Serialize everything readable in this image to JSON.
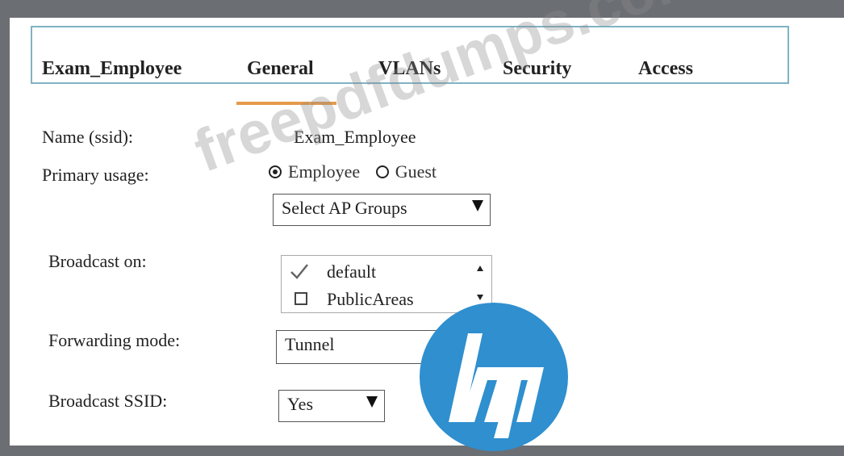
{
  "tabs": {
    "profile": "Exam_Employee",
    "general": "General",
    "vlans": "VLANs",
    "security": "Security",
    "access": "Access"
  },
  "form": {
    "name_label": "Name (ssid):",
    "name_value": "Exam_Employee",
    "usage_label": "Primary usage:",
    "usage_employee": "Employee",
    "usage_guest": "Guest",
    "usage_selected": "Employee",
    "ap_groups_select": "Select AP Groups",
    "broadcast_label": "Broadcast on:",
    "broadcast_items": [
      {
        "label": "default",
        "checked": true
      },
      {
        "label": "PublicAreas",
        "checked": false
      }
    ],
    "forwarding_label": "Forwarding mode:",
    "forwarding_value": "Tunnel",
    "ssid_label": "Broadcast SSID:",
    "ssid_value": "Yes"
  },
  "watermark": "freepdfdumps.com",
  "colors": {
    "tab_border": "#7fb3c4",
    "tab_underline": "#e59a4a",
    "hp_blue": "#2f8fcf",
    "background": "#6b6e73"
  }
}
